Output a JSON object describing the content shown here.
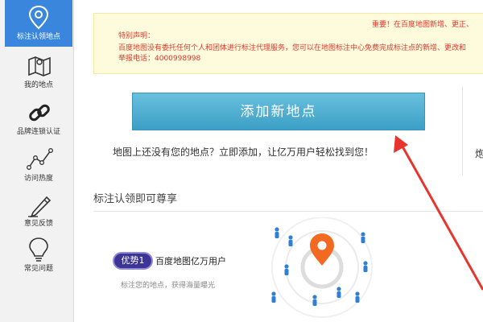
{
  "sidebar": {
    "items": [
      {
        "label": "标注认领地点",
        "icon": "map-pin-icon",
        "active": true
      },
      {
        "label": "我的地点",
        "icon": "folded-map-icon"
      },
      {
        "label": "品牌连锁认证",
        "icon": "chain-link-icon"
      },
      {
        "label": "访问热度",
        "icon": "line-chart-icon"
      },
      {
        "label": "意见反馈",
        "icon": "pencil-icon"
      },
      {
        "label": "常见问题",
        "icon": "lightbulb-icon"
      }
    ]
  },
  "notice": {
    "important": "重要！在百度地图新增、更正、",
    "line1": "特别声明：",
    "line2": "百度地图没有委托任何个人和团体进行标注代理服务，您可以在地图标注中心免费完成标注点的新增、更改和",
    "line3": "举报电话：4000998998"
  },
  "add_button": {
    "label": "添加新地点"
  },
  "promo_text": "地图上还没有您的地点？立即添加，让亿万用户轻松找到您！",
  "right_partial": "炮",
  "section": {
    "title": "标注认领即可尊享"
  },
  "advantage": {
    "badge": "优势1",
    "title": "百度地图亿万用户",
    "desc": "标注您的地点，获得海量曝光"
  },
  "colors": {
    "sidebar_active": "#3a86dc",
    "button": "#4aaed3",
    "notice_text": "#e0362b",
    "pin": "#f26a21",
    "annotation_arrow": "#e8342d"
  }
}
